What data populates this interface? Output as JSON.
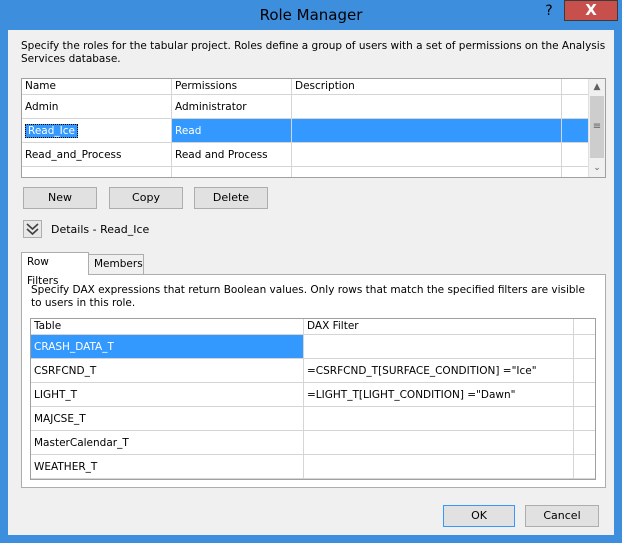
{
  "window": {
    "title": "Role Manager",
    "help_glyph": "?",
    "close_glyph": "X"
  },
  "instruction": "Specify the roles for the tabular project. Roles define a group of users with a set of permissions on the Analysis Services database.",
  "roles_grid": {
    "columns": [
      "Name",
      "Permissions",
      "Description"
    ],
    "rows": [
      {
        "name": "Admin",
        "permissions": "Administrator",
        "description": ""
      },
      {
        "name": "Read_Ice",
        "permissions": "Read",
        "description": ""
      },
      {
        "name": "Read_and_Process",
        "permissions": "Read and Process",
        "description": ""
      }
    ],
    "selected_row": 1
  },
  "buttons": {
    "new": "New",
    "copy": "Copy",
    "delete": "Delete",
    "ok": "OK",
    "cancel": "Cancel"
  },
  "details": {
    "label": "Details - Read_Ice"
  },
  "tabs": [
    {
      "label": "Row Filters",
      "active": true
    },
    {
      "label": "Members",
      "active": false
    }
  ],
  "row_filters": {
    "instruction": "Specify DAX expressions that return Boolean values. Only rows that match the specified filters are visible to users in this role.",
    "columns": [
      "Table",
      "DAX Filter"
    ],
    "rows": [
      {
        "table": "CRASH_DATA_T",
        "filter": ""
      },
      {
        "table": "CSRFCND_T",
        "filter": "=CSRFCND_T[SURFACE_CONDITION] =\"Ice\""
      },
      {
        "table": "LIGHT_T",
        "filter": "=LIGHT_T[LIGHT_CONDITION] =\"Dawn\""
      },
      {
        "table": "MAJCSE_T",
        "filter": ""
      },
      {
        "table": "MasterCalendar_T",
        "filter": ""
      },
      {
        "table": "WEATHER_T",
        "filter": ""
      }
    ],
    "selected_row": 0
  },
  "colors": {
    "title_bar": "#3e8ede",
    "close_button": "#c7504c",
    "selection": "#3399ff",
    "dialog_bg": "#f0f0f0"
  }
}
